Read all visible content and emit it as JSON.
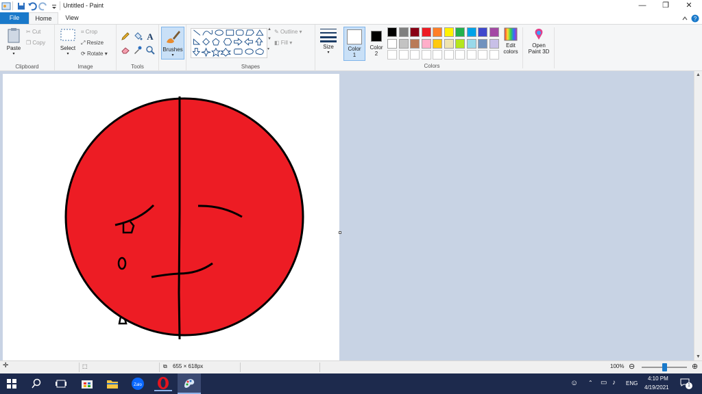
{
  "window": {
    "title": "Untitled - Paint",
    "minimize": "—",
    "restore": "❐",
    "close": "✕"
  },
  "tabs": [
    {
      "label": "File"
    },
    {
      "label": "Home"
    },
    {
      "label": "View"
    }
  ],
  "ribbon": {
    "clipboard": {
      "paste": "Paste",
      "cut": "Cut",
      "copy": "Copy",
      "group": "Clipboard"
    },
    "image": {
      "select": "Select",
      "crop": "Crop",
      "resize": "Resize",
      "rotate": "Rotate",
      "group": "Image"
    },
    "tools": {
      "group": "Tools"
    },
    "brushes": {
      "label": "Brushes"
    },
    "shapes": {
      "outline": "Outline",
      "fill": "Fill",
      "group": "Shapes"
    },
    "size": {
      "label": "Size"
    },
    "color1": {
      "label": "Color",
      "num": "1",
      "value": "#ffffff"
    },
    "color2": {
      "label": "Color",
      "num": "2",
      "value": "#000000"
    },
    "colors": {
      "group": "Colors",
      "row1": [
        "#000000",
        "#7f7f7f",
        "#880015",
        "#ed1c24",
        "#ff7f27",
        "#fff200",
        "#22b14c",
        "#00a2e8",
        "#3f48cc",
        "#a349a4"
      ],
      "row2": [
        "#ffffff",
        "#c3c3c3",
        "#b97a57",
        "#ffaec9",
        "#ffc90e",
        "#efe4b0",
        "#b5e61d",
        "#99d9ea",
        "#7092be",
        "#c8bfe7"
      ],
      "row3": [
        "#ffffff",
        "#ffffff",
        "#ffffff",
        "#ffffff",
        "#ffffff",
        "#ffffff",
        "#ffffff",
        "#ffffff",
        "#ffffff",
        "#ffffff"
      ]
    },
    "edit_colors": {
      "line1": "Edit",
      "line2": "colors"
    },
    "paint3d": {
      "line1": "Open",
      "line2": "Paint 3D"
    }
  },
  "drawing": {
    "fill": "#ed1c24",
    "stroke": "#000000"
  },
  "status": {
    "image_size": "655 × 618px",
    "zoom": "100%",
    "zoom_fraction": 0.5
  },
  "taskbar": {
    "lang": "ENG",
    "time": "4:10 PM",
    "date": "4/19/2021",
    "notif_count": "1",
    "zalo": "Zalo"
  }
}
